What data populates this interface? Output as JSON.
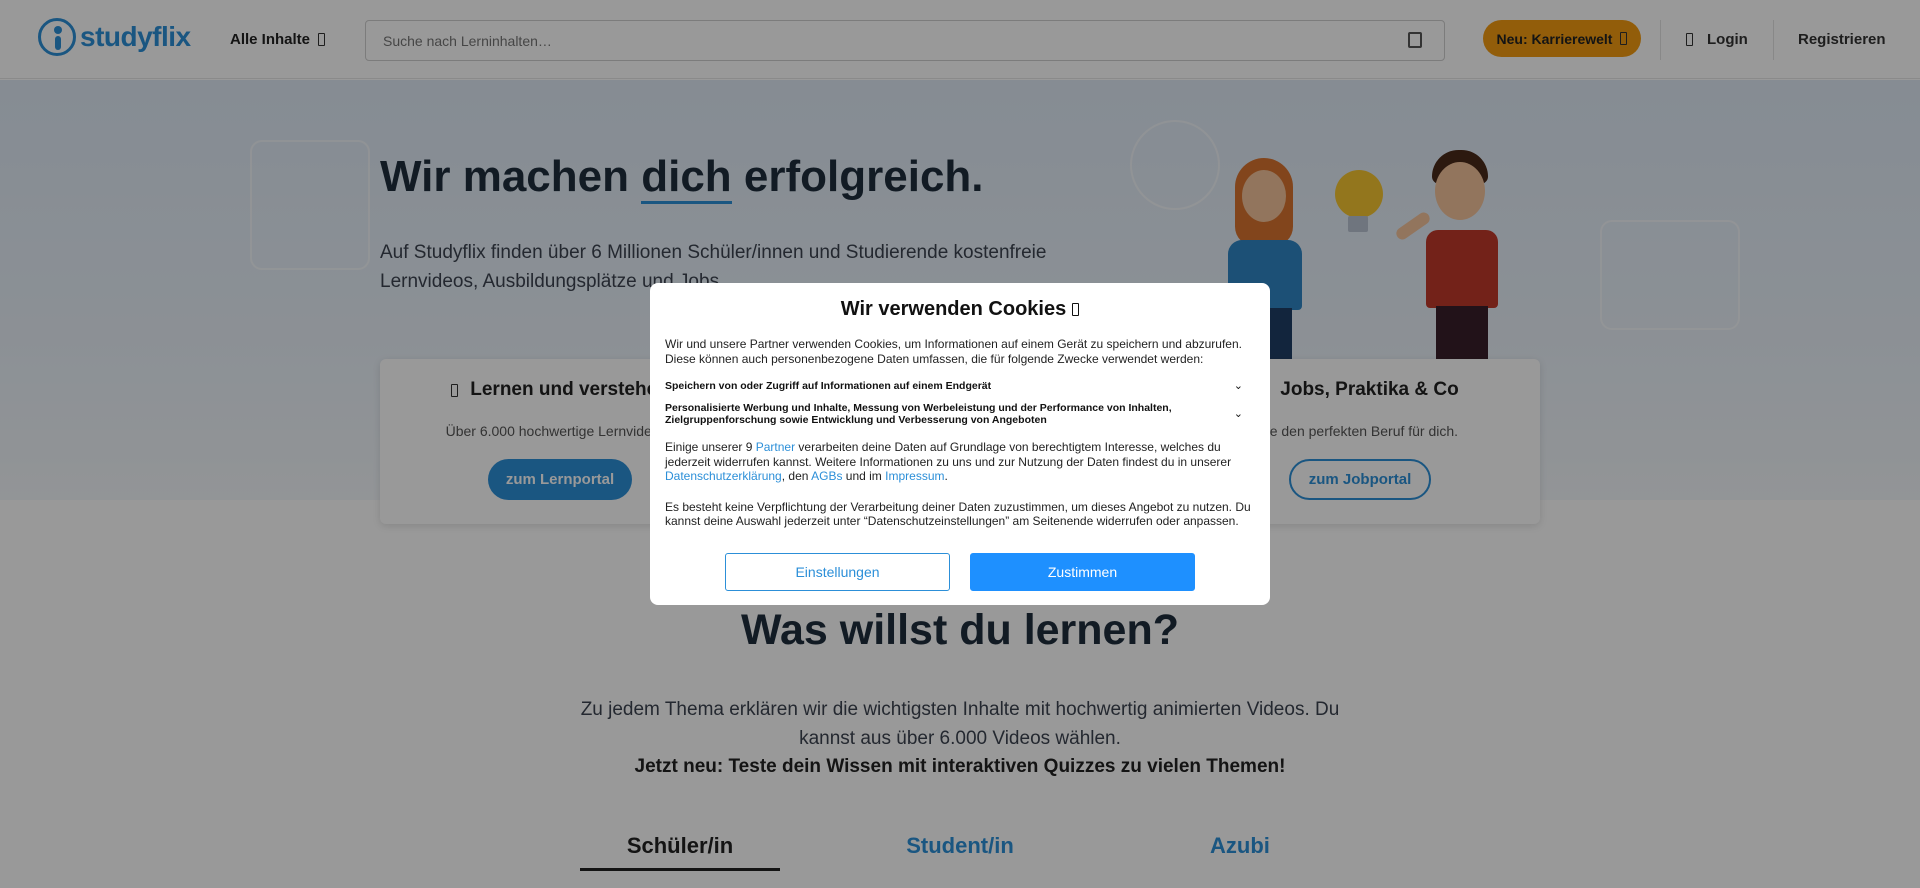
{
  "header": {
    "logo_text": "studyflix",
    "nav_all": "Alle Inhalte",
    "search_placeholder": "Suche nach Lerninhalten…",
    "career_button": "Neu: Karrierewelt",
    "login": "Login",
    "register": "Registrieren"
  },
  "hero": {
    "title_before": "Wir machen ",
    "title_highlight": "dich",
    "title_after": " erfolgreich.",
    "text": "Auf Studyflix finden über 6 Millionen Schüler/innen und Studierende kostenfreie Lernvideos, Ausbildungsplätze und Jobs."
  },
  "cards": [
    {
      "title": "Lernen und verstehen",
      "text": "Über 6.000 hochwertige Lernvideos f",
      "cta": "zum Lernportal"
    },
    {
      "title": "Jobs, Praktika & Co",
      "text": "de den perfekten Beruf für dich.",
      "cta": "zum Jobportal"
    }
  ],
  "section": {
    "title": "Was willst du lernen?",
    "text": "Zu jedem Thema erklären wir die wichtigsten Inhalte mit hochwertig animierten Videos. Du kannst aus über 6.000 Videos wählen.",
    "bold": "Jetzt neu: Teste dein Wissen mit interaktiven Quizzes zu vielen Themen!",
    "tabs": [
      "Schüler/in",
      "Student/in",
      "Azubi"
    ]
  },
  "cookie_modal": {
    "title": "Wir verwenden Cookies",
    "intro": "Wir und unsere Partner verwenden Cookies, um Informationen auf einem Gerät zu speichern und abzurufen. Diese können auch personenbezogene Daten umfassen, die für folgende Zwecke verwendet werden:",
    "purpose_1": "Speichern von oder Zugriff auf Informationen auf einem Endgerät",
    "purpose_2": "Personalisierte Werbung und Inhalte, Messung von Werbeleistung und der Performance von Inhalten, Zielgruppenforschung sowie Entwicklung und Verbesserung von Angeboten",
    "para_1_a": "Einige unserer 9 ",
    "link_partner": "Partner",
    "para_1_b": " verarbeiten deine Daten auf Grundlage von berechtigtem Interesse, welches du jederzeit widerrufen kannst. Weitere Informationen zu uns und zur Nutzung der Daten findest du in unserer ",
    "link_privacy": "Datenschutzerklärung",
    "para_1_c": ", den ",
    "link_agb": "AGBs",
    "para_1_d": " und im ",
    "link_imprint": "Impressum",
    "para_1_e": ".",
    "para_2": "Es besteht keine Verpflichtung der Verarbeitung deiner Daten zuzustimmen, um dieses Angebot zu nutzen. Du kannst deine Auswahl jederzeit unter “Datenschutzeinstellungen” am Seitenende widerrufen oder anpassen.",
    "btn_settings": "Einstellungen",
    "btn_accept": "Zustimmen"
  },
  "colors": {
    "brand_blue": "#2c8fd8",
    "career_orange": "#f39c12",
    "accept_blue": "#1e90ff"
  }
}
